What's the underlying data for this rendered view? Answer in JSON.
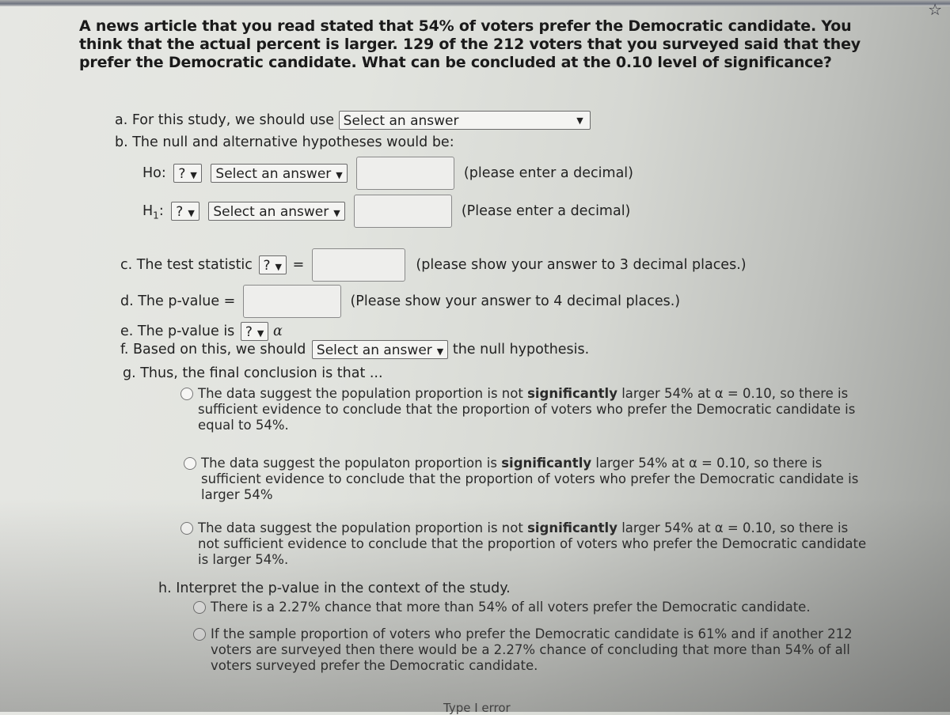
{
  "question": {
    "text": "A news article that you read stated that 54% of voters prefer the Democratic candidate. You think that the actual percent is larger. 129 of the 212 voters that you surveyed said that they prefer the Democratic candidate. What can be concluded at the 0.10 level of significance?"
  },
  "part_a": {
    "label": "a. For this study, we should use",
    "select_value": "Select an answer"
  },
  "part_b": {
    "label": "b. The null and alternative hypotheses would be:",
    "h0": {
      "label": "Ho:",
      "operator_select": "?",
      "param_select": "Select an answer",
      "value": "",
      "hint": "(please enter a decimal)"
    },
    "h1": {
      "label": "H",
      "label_sub": "1",
      "label_suffix": ":",
      "operator_select": "?",
      "param_select": "Select an answer",
      "value": "",
      "hint": "(Please enter a decimal)"
    }
  },
  "part_c": {
    "label": "c. The test statistic",
    "stat_select": "?",
    "equals": "=",
    "value": "",
    "hint": "(please show your answer to 3 decimal places.)"
  },
  "part_d": {
    "label": "d. The p-value =",
    "value": "",
    "hint": "(Please show your answer to 4 decimal places.)"
  },
  "part_e": {
    "label": "e. The p-value is",
    "compare_select": "?",
    "alpha": "α"
  },
  "part_f": {
    "label": "f. Based on this, we should",
    "select_value": "Select an answer",
    "suffix": "the null hypothesis."
  },
  "part_g": {
    "label": "g. Thus, the final conclusion is that ...",
    "options": [
      {
        "pre": "The data suggest the population proportion is not ",
        "bold": "significantly",
        "post": " larger 54% at α = 0.10, so there is sufficient evidence to conclude that the proportion of voters who prefer the Democratic candidate is equal to 54%.",
        "selected": false
      },
      {
        "pre": "The data suggest the populaton proportion is ",
        "bold": "significantly",
        "post": " larger 54% at α = 0.10, so there is sufficient evidence to conclude that the proportion of voters who prefer the Democratic candidate is larger 54%",
        "selected": false
      },
      {
        "pre": "The data suggest the population proportion is not ",
        "bold": "significantly",
        "post": " larger 54% at α = 0.10, so there is not sufficient evidence to conclude that the proportion of voters who prefer the Democratic candidate is larger 54%.",
        "selected": false
      }
    ]
  },
  "part_h": {
    "label": "h. Interpret the p-value in the context of the study.",
    "options": [
      {
        "text": "There is a 2.27% chance that more than 54% of all voters prefer the Democratic candidate.",
        "selected": false
      },
      {
        "text": "If the sample proportion of voters who prefer the Democratic candidate is 61% and if another 212 voters are surveyed then there would be a 2.27% chance of concluding that more than 54% of all voters surveyed prefer the Democratic candidate.",
        "selected": false
      }
    ]
  },
  "partial_text_bottom": "Type I error",
  "icons": {
    "star": "☆"
  }
}
